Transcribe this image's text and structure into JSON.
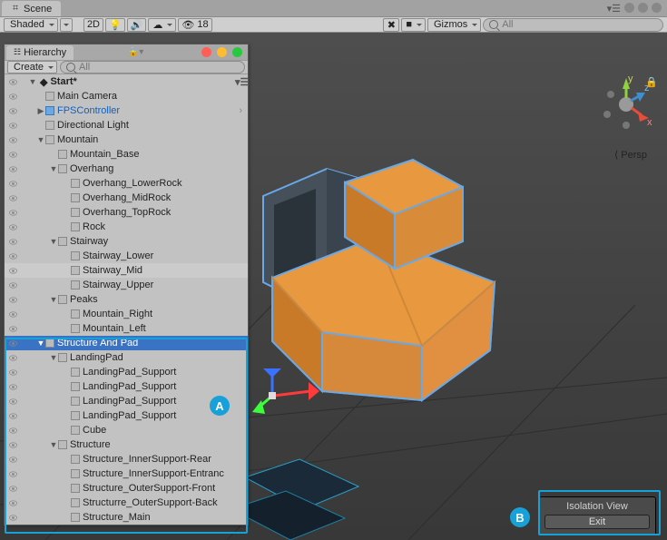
{
  "scene_tab": {
    "title": "Scene"
  },
  "scene_toolbar": {
    "shading": "Shaded",
    "twoD": "2D",
    "audio_count": "18",
    "gizmos": "Gizmos",
    "search_placeholder": "All"
  },
  "perspective_label": "Persp",
  "axes": {
    "x": "x",
    "y": "y",
    "z": "z"
  },
  "hierarchy": {
    "tab_title": "Hierarchy",
    "create_label": "Create",
    "search_placeholder": "All",
    "scene_name": "Start*",
    "items": [
      {
        "label": "Main Camera",
        "indent": 1,
        "prefab": false
      },
      {
        "label": "FPSController",
        "indent": 1,
        "prefab": true,
        "fold": "▶",
        "chevron": true
      },
      {
        "label": "Directional Light",
        "indent": 1
      },
      {
        "label": "Mountain",
        "indent": 1,
        "fold": "▼"
      },
      {
        "label": "Mountain_Base",
        "indent": 2
      },
      {
        "label": "Overhang",
        "indent": 2,
        "fold": "▼"
      },
      {
        "label": "Overhang_LowerRock",
        "indent": 3
      },
      {
        "label": "Overhang_MidRock",
        "indent": 3
      },
      {
        "label": "Overhang_TopRock",
        "indent": 3
      },
      {
        "label": "Rock",
        "indent": 3
      },
      {
        "label": "Stairway",
        "indent": 2,
        "fold": "▼"
      },
      {
        "label": "Stairway_Lower",
        "indent": 3
      },
      {
        "label": "Stairway_Mid",
        "indent": 3,
        "hl": true
      },
      {
        "label": "Stairway_Upper",
        "indent": 3
      },
      {
        "label": "Peaks",
        "indent": 2,
        "fold": "▼"
      },
      {
        "label": "Mountain_Right",
        "indent": 3
      },
      {
        "label": "Mountain_Left",
        "indent": 3
      },
      {
        "label": "Structure And Pad",
        "indent": 1,
        "fold": "▼",
        "sel": true
      },
      {
        "label": "LandingPad",
        "indent": 2,
        "fold": "▼"
      },
      {
        "label": "LandingPad_Support",
        "indent": 3
      },
      {
        "label": "LandingPad_Support",
        "indent": 3
      },
      {
        "label": "LandingPad_Support",
        "indent": 3
      },
      {
        "label": "LandingPad_Support",
        "indent": 3
      },
      {
        "label": "Cube",
        "indent": 3
      },
      {
        "label": "Structure",
        "indent": 2,
        "fold": "▼"
      },
      {
        "label": "Structure_InnerSupport-Rear",
        "indent": 3
      },
      {
        "label": "Structure_InnerSupport-Entranc",
        "indent": 3
      },
      {
        "label": "Structure_OuterSupport-Front",
        "indent": 3
      },
      {
        "label": "Structurre_OuterSupport-Back",
        "indent": 3
      },
      {
        "label": "Structure_Main",
        "indent": 3
      }
    ]
  },
  "isolation": {
    "title": "Isolation View",
    "exit": "Exit"
  },
  "annotations": {
    "A": "A",
    "B": "B"
  }
}
